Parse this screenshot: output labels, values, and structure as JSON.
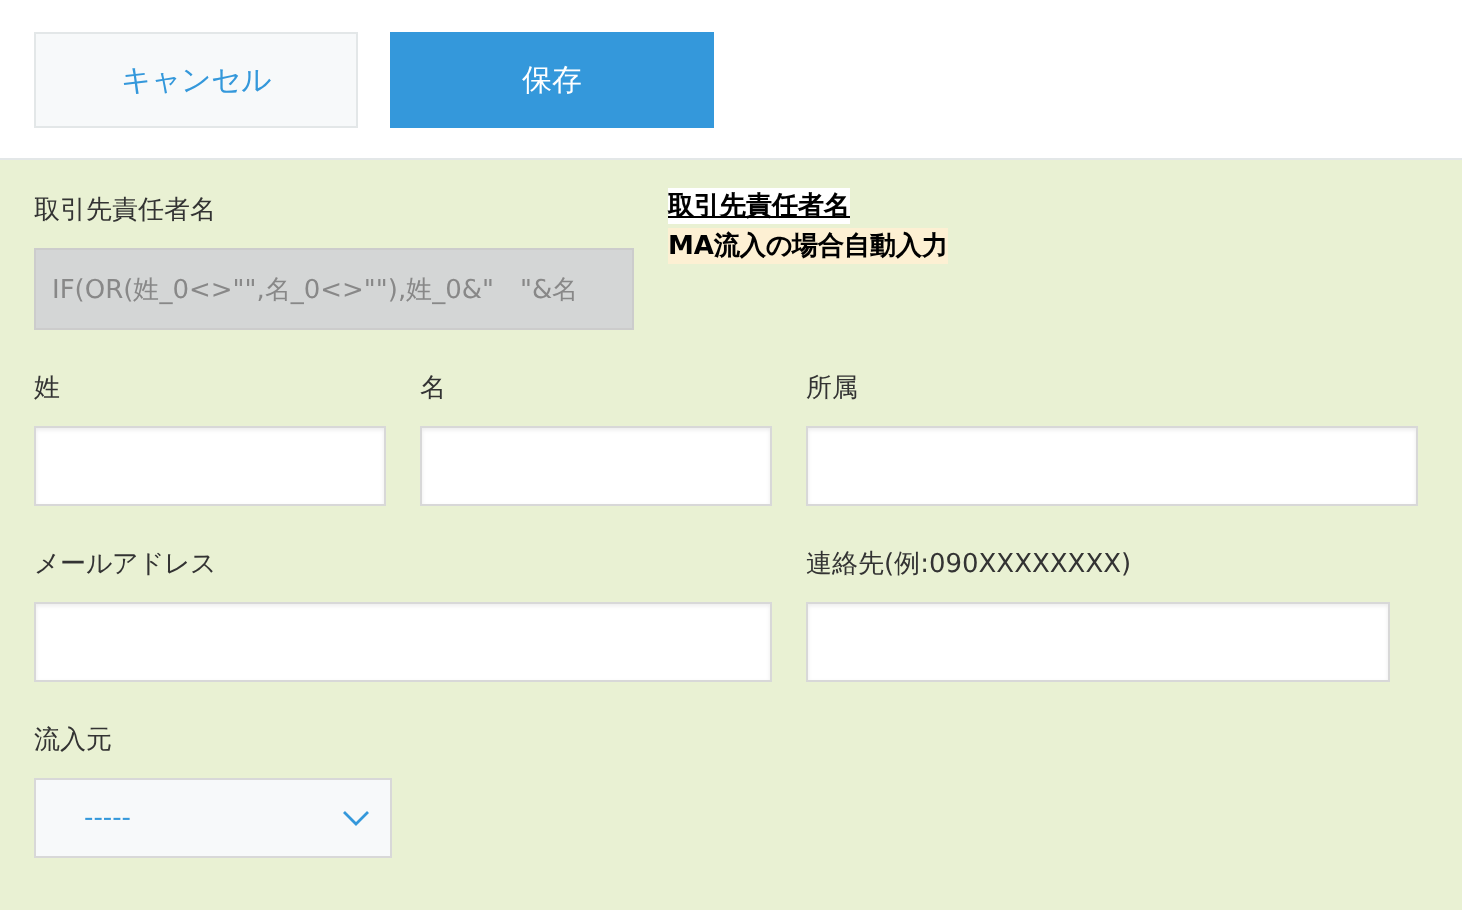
{
  "buttons": [
    {
      "label": "キャンセル",
      "kind": "secondary"
    },
    {
      "label": "保存",
      "kind": "primary"
    }
  ],
  "rows": [
    [
      {
        "kind": "calc",
        "label": "取引先責任者名",
        "value": "IF(OR(姓_0<>\"\",名_0<>\"\"),姓_0&\"　\"&名"
      },
      {
        "kind": "note",
        "lines": [
          "取引先責任者名",
          "MA流入の場合自動入力"
        ]
      }
    ],
    [
      {
        "kind": "text",
        "label": "姓"
      },
      {
        "kind": "text",
        "label": "名"
      },
      {
        "kind": "text",
        "label": "所属"
      }
    ],
    [
      {
        "kind": "text",
        "label": "メールアドレス"
      },
      {
        "kind": "text",
        "label": "連絡先(例:090XXXXXXXX)"
      }
    ],
    [
      {
        "kind": "select",
        "label": "流入元",
        "value": "-----"
      }
    ]
  ]
}
